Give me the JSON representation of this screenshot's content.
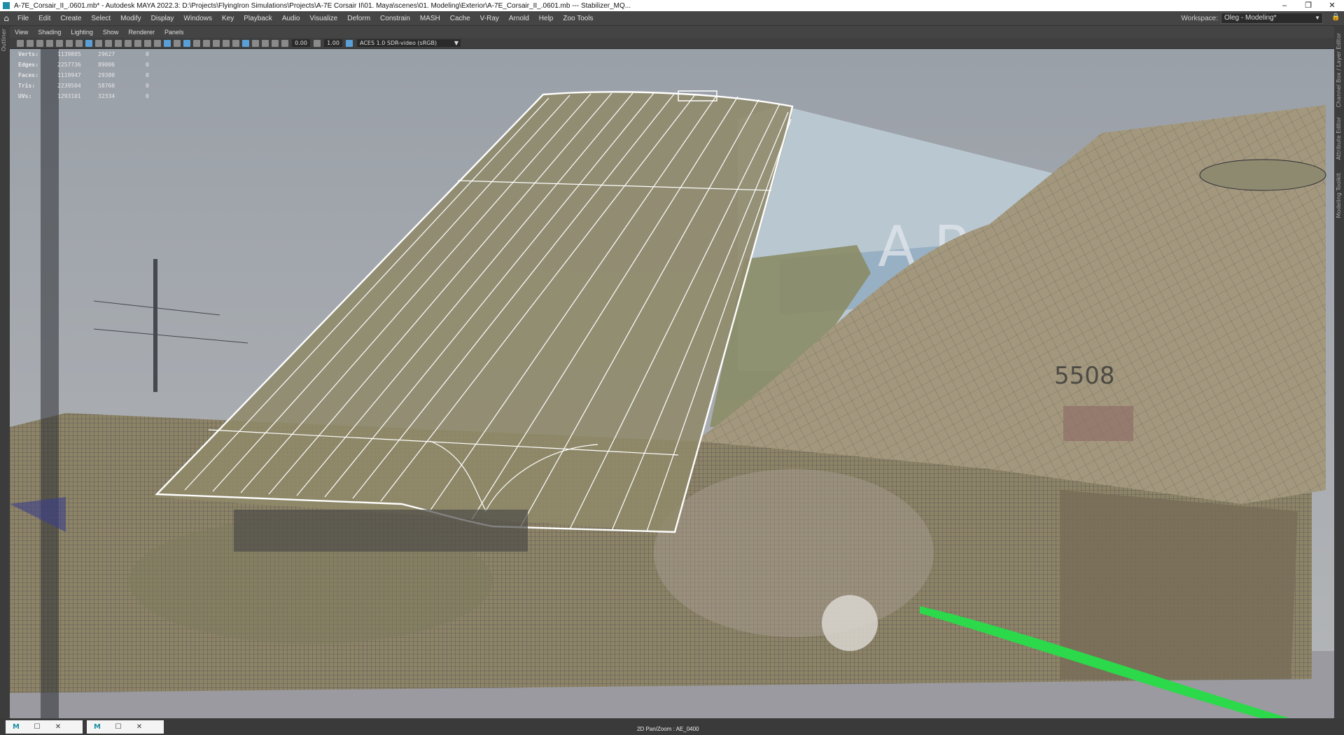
{
  "window": {
    "title": "A-7E_Corsair_II_.0601.mb* - Autodesk MAYA 2022.3: D:\\Projects\\FlyingIron Simulations\\Projects\\A-7E Corsair II\\01. Maya\\scenes\\01. Modeling\\Exterior\\A-7E_Corsair_II_.0601.mb  ---  Stabilizer_MQ...",
    "minimize": "–",
    "restore": "❐",
    "close": "✕"
  },
  "menu": [
    "File",
    "Edit",
    "Create",
    "Select",
    "Modify",
    "Display",
    "Windows",
    "Key",
    "Playback",
    "Audio",
    "Visualize",
    "Deform",
    "Constrain",
    "MASH",
    "Cache",
    "V-Ray",
    "Arnold",
    "Help",
    "Zoo Tools"
  ],
  "workspace": {
    "label": "Workspace:",
    "value": "Oleg - Modeling*"
  },
  "panel_menu": [
    "View",
    "Shading",
    "Lighting",
    "Show",
    "Renderer",
    "Panels"
  ],
  "panel_toolbar": {
    "exposure": "0.00",
    "gamma": "1.00",
    "color_space": "ACES 1.0 SDR-video (sRGB)"
  },
  "hud": [
    {
      "label": "Verts:",
      "a": "1139805",
      "b": "29627",
      "c": "0"
    },
    {
      "label": "Edges:",
      "a": "2257736",
      "b": "89006",
      "c": "0"
    },
    {
      "label": "Faces:",
      "a": "1119947",
      "b": "29380",
      "c": "0"
    },
    {
      "label": "Tris:",
      "a": "2239504",
      "b": "58760",
      "c": "0"
    },
    {
      "label": "UVs:",
      "a": "1293101",
      "b": "32334",
      "c": "0"
    }
  ],
  "viewport": {
    "camera_label": "2D Pan/Zoom : AE_0400",
    "tail_code": "5508",
    "hangar_text": "A R"
  },
  "left_strip_label": "Outliner",
  "right_strip_labels": [
    "Channel Box / Layer Editor",
    "Attribute Editor",
    "Modeling Toolkit"
  ],
  "taskbar": {
    "btn1_icon": "M",
    "btn2_icon": "M"
  },
  "colors": {
    "accent": "#5aa0d6",
    "wire": "#ffffff",
    "green_sel": "#2bd94a"
  }
}
